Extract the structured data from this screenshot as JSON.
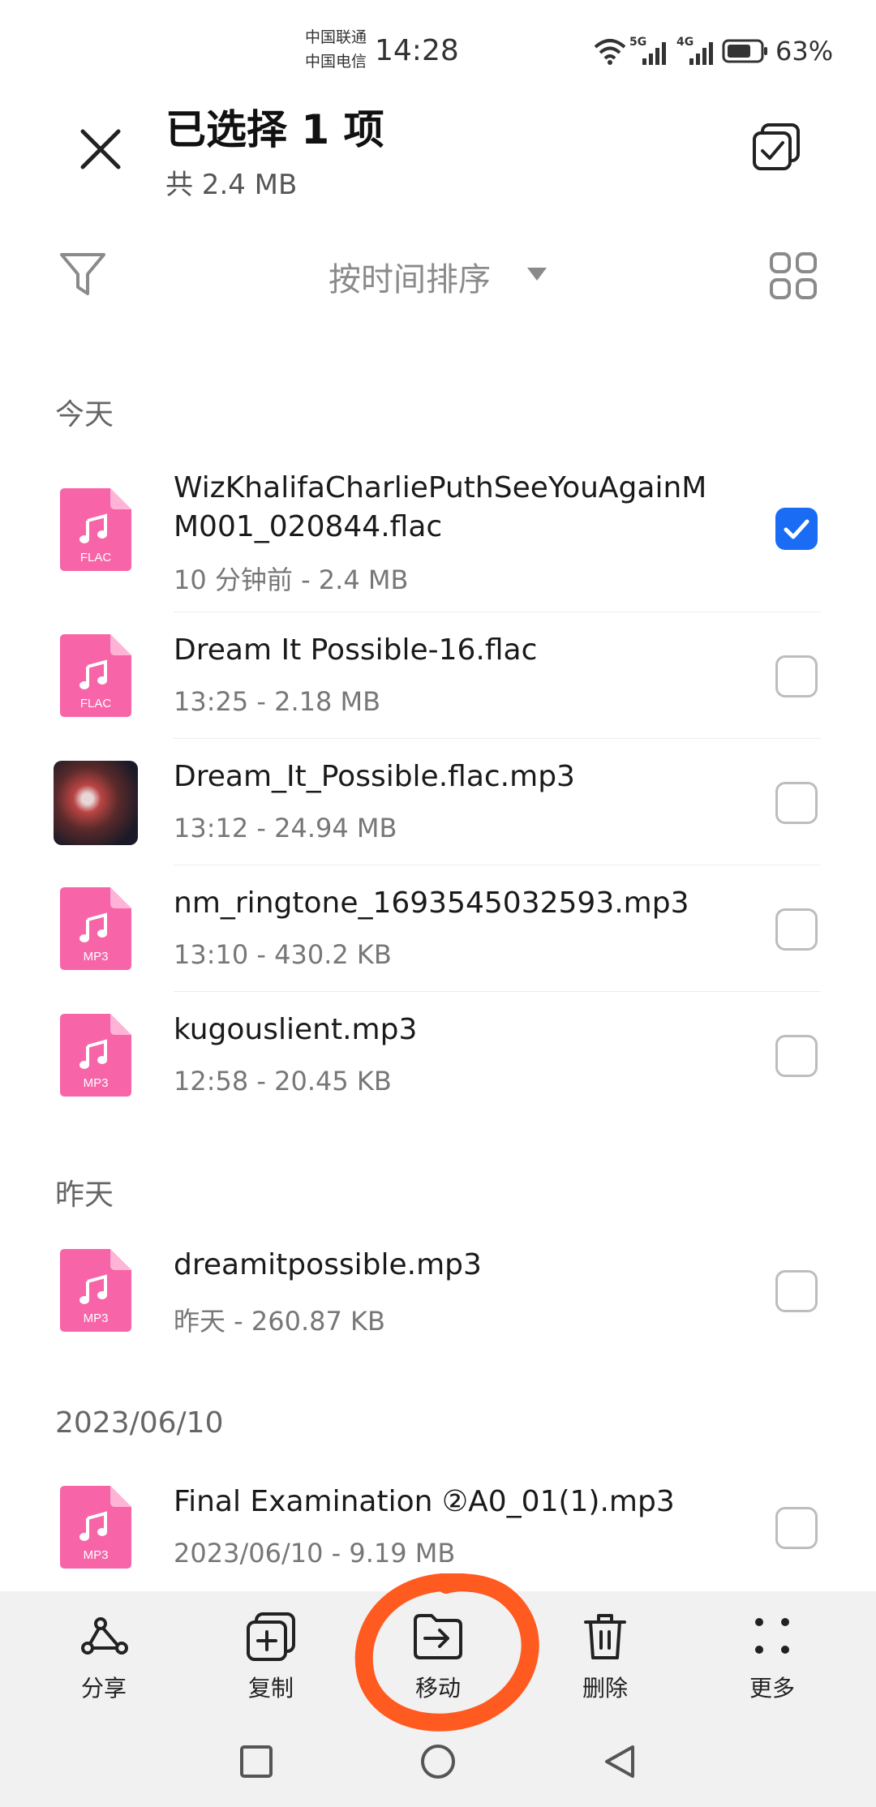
{
  "status_bar": {
    "carrier_1": "中国联通",
    "carrier_2": "中国电信",
    "time": "14:28",
    "network_1": "5G",
    "network_2": "4G",
    "battery": "63%"
  },
  "header": {
    "title": "已选择 1 项",
    "subtitle": "共 2.4 MB"
  },
  "sort": {
    "label": "按时间排序"
  },
  "sections": [
    {
      "label": "今天"
    },
    {
      "label": "昨天"
    },
    {
      "label": "2023/06/10"
    }
  ],
  "files": [
    {
      "name": "WizKhalifaCharliePuthSeeYouAgainMM001_020844.flac",
      "meta": "10 分钟前 - 2.4 MB",
      "badge": "FLAC",
      "checked": true
    },
    {
      "name": "Dream It Possible-16.flac",
      "meta": "13:25 - 2.18 MB",
      "badge": "FLAC",
      "checked": false
    },
    {
      "name": "Dream_It_Possible.flac.mp3",
      "meta": "13:12 - 24.94 MB",
      "badge": "",
      "checked": false
    },
    {
      "name": "nm_ringtone_1693545032593.mp3",
      "meta": "13:10 - 430.2 KB",
      "badge": "MP3",
      "checked": false
    },
    {
      "name": "kugouslient.mp3",
      "meta": "12:58 - 20.45 KB",
      "badge": "MP3",
      "checked": false
    },
    {
      "name": "dreamitpossible.mp3",
      "meta": "昨天 - 260.87 KB",
      "badge": "MP3",
      "checked": false
    },
    {
      "name": "Final Examination ②A0_01(1).mp3",
      "meta": "2023/06/10 - 9.19 MB",
      "badge": "MP3",
      "checked": false
    }
  ],
  "toolbar": {
    "share": "分享",
    "copy": "复制",
    "move": "移动",
    "delete": "删除",
    "more": "更多"
  },
  "colors": {
    "accent": "#1a6cf5",
    "file_icon": "#f765a8",
    "annotation": "#ff5a1f"
  }
}
